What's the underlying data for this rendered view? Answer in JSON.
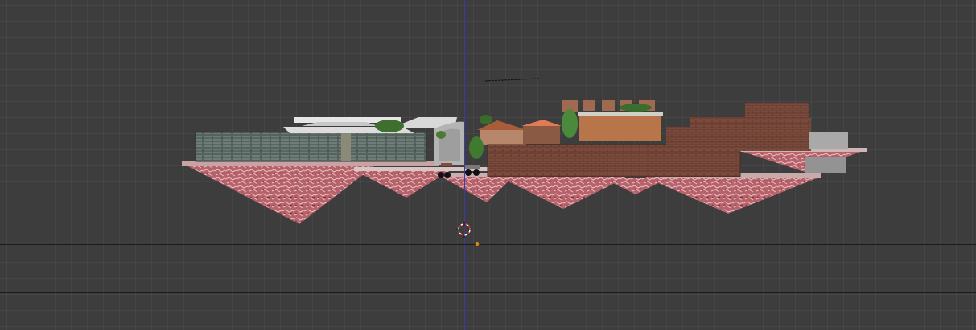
{
  "viewport": {
    "background_color": "#3d3d3d",
    "grid_color": "#4a4a4a",
    "z_axis_color": "#3a3aa8",
    "y_axis_color": "#4f8a3c"
  },
  "scene": {
    "object": "textured-terrain-model",
    "icons": [
      "3d-cursor-icon",
      "object-origin-icon"
    ]
  }
}
